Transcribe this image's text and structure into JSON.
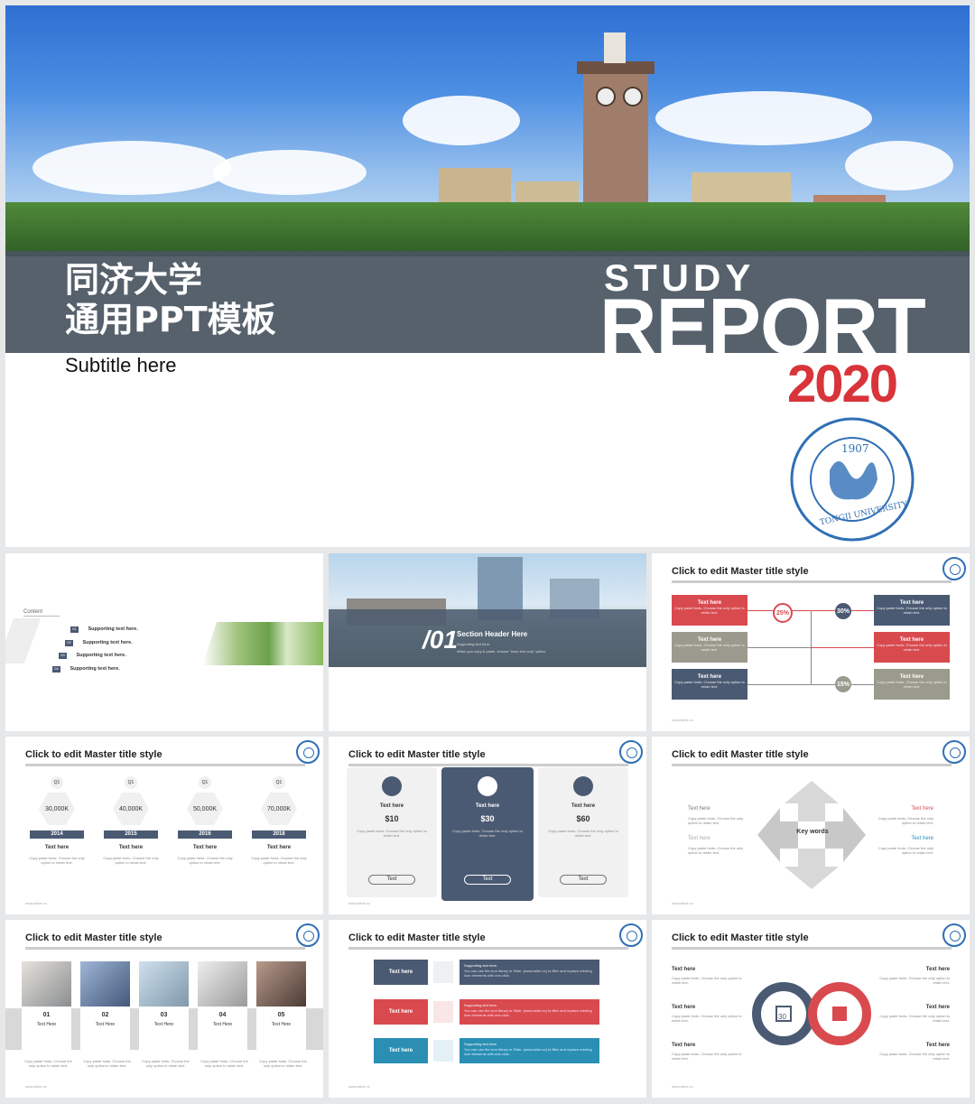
{
  "cover": {
    "cn_title": "同济大学\n通用PPT模板",
    "subtitle": "Subtitle here",
    "study": "STUDY",
    "report": "REPORT",
    "year": "2020",
    "seal_year": "1907",
    "seal_text": "TONGJI UNIVERSITY"
  },
  "contents": {
    "label": "Content",
    "items": [
      "Supporting text here.",
      "Supporting text here.",
      "Supporting text here.",
      "Supporting text here."
    ],
    "nums": [
      "01",
      "02",
      "03",
      "04"
    ]
  },
  "section": {
    "number": "/01",
    "header": "Section Header Here",
    "support": "Supporting text here.",
    "hint": "When you copy & paste, choose \"keep text only\" option."
  },
  "master_title": "Click to edit Master title style",
  "flow": {
    "boxes": [
      "Text here",
      "Text here",
      "Text here",
      "Text here",
      "Text here",
      "Text here"
    ],
    "box_text": "Copy paste fonts. Choose the only option to retain text.",
    "pcts": [
      "25%",
      "30%",
      "15%"
    ]
  },
  "timeline": {
    "quarters": [
      "Q1",
      "Q1",
      "Q1",
      "Q1"
    ],
    "values": [
      "30,000K",
      "40,000K",
      "50,000K",
      "70,000K"
    ],
    "years": [
      "2014",
      "2015",
      "2016",
      "2018"
    ],
    "label": "Text here",
    "desc": "Copy paste fonts. Choose the only option to retain text."
  },
  "pricing": {
    "label": "Text here",
    "prices": [
      "$10",
      "$30",
      "$60"
    ],
    "desc": "Copy paste fonts. Choose the only option to retain text.",
    "btn": "Text"
  },
  "cycle": {
    "center": "Key words",
    "labels": [
      "Text here",
      "Text here",
      "Text here",
      "Text here"
    ],
    "desc": "Copy paste fonts. Choose the only option to retain text."
  },
  "photos": {
    "nums": [
      "01",
      "02",
      "03",
      "04",
      "05"
    ],
    "label": "Text Here",
    "desc": "Copy paste fonts. Choose the only option to retain text."
  },
  "ribbons": {
    "labels": [
      "Text here",
      "Text here",
      "Text here"
    ],
    "support": "Supporting text here.",
    "desc": "You can use the icon library in Slide. (www.islide.cc) to filter and replace existing icon elements with one click."
  },
  "infinity": {
    "labels": [
      "Text here",
      "Text here",
      "Text here",
      "Text here",
      "Text here",
      "Text here"
    ],
    "desc": "Copy paste fonts. Choose the only option to retain text.",
    "icon_num": "30"
  },
  "footer": "www.islide.cc",
  "colors": {
    "navy": "#4b5a73",
    "red": "#d94a4f",
    "grey": "#9b9a8e",
    "teal": "#2a8fb3"
  }
}
